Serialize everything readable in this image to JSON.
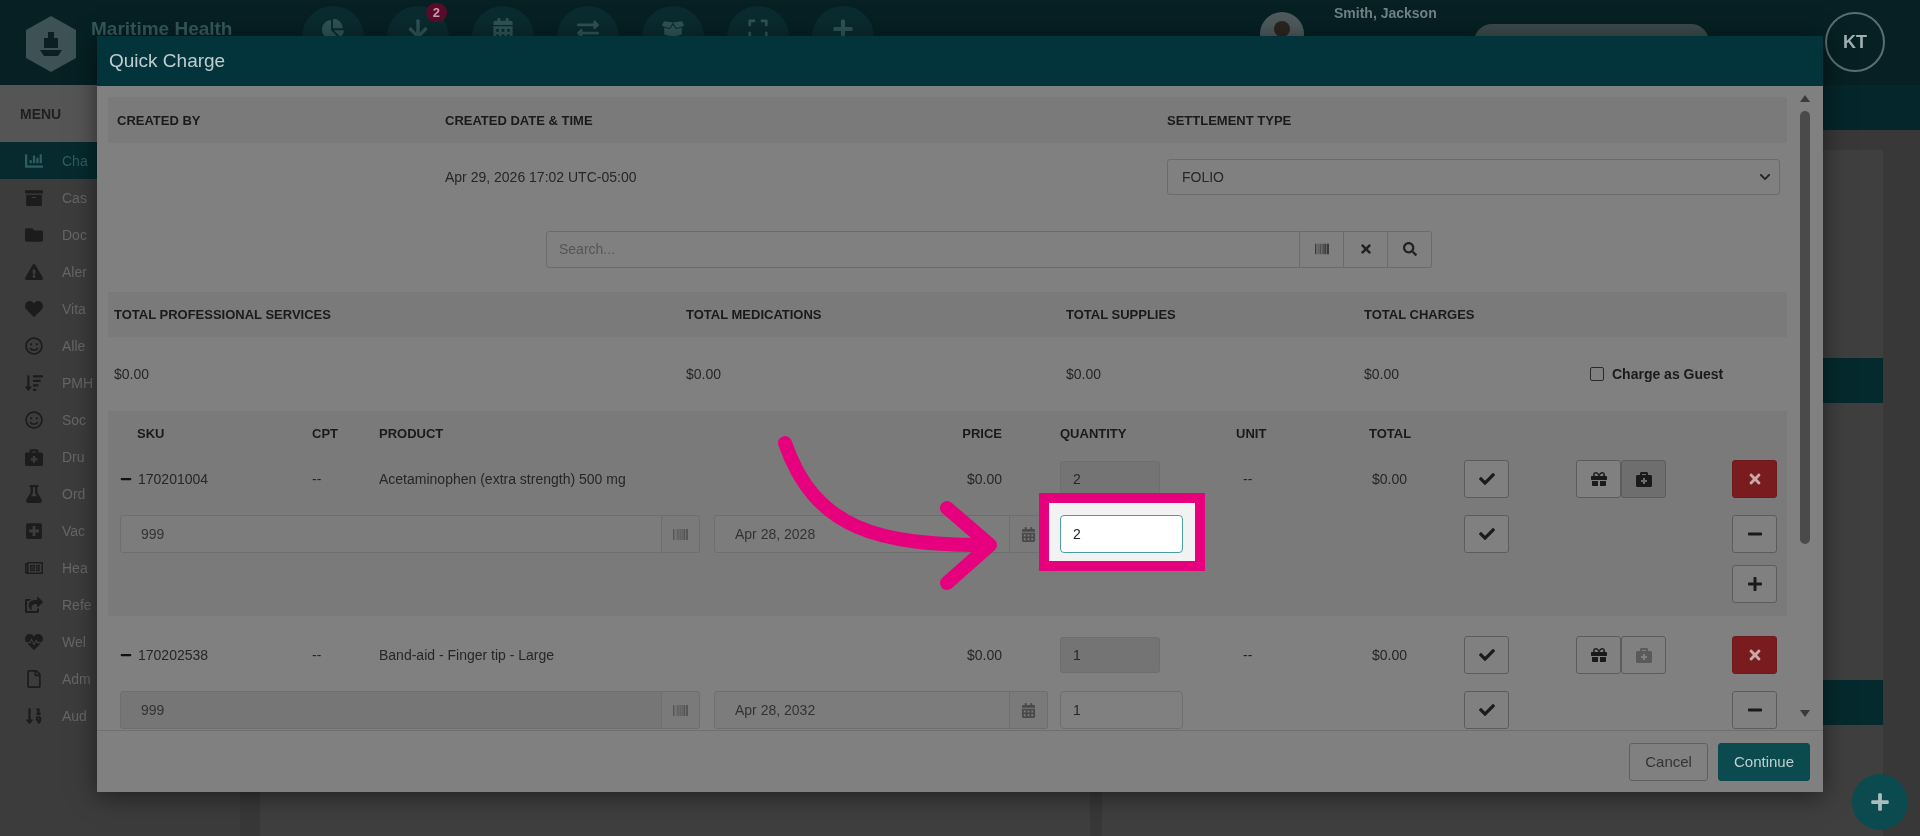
{
  "app": {
    "title": "Maritime Health",
    "notification_count": "2",
    "patient_name": "Smith, Jackson",
    "user_initials": "KT",
    "menu_label": "MENU",
    "sidebar": [
      {
        "label": "Cha",
        "selected": true
      },
      {
        "label": "Cas",
        "selected": false
      },
      {
        "label": "Doc",
        "selected": false
      },
      {
        "label": "Aler",
        "selected": false
      },
      {
        "label": "Vita",
        "selected": false
      },
      {
        "label": "Alle",
        "selected": false
      },
      {
        "label": "PMH",
        "selected": false
      },
      {
        "label": "Soc",
        "selected": false
      },
      {
        "label": "Dru",
        "selected": false
      },
      {
        "label": "Ord",
        "selected": false
      },
      {
        "label": "Vac",
        "selected": false
      },
      {
        "label": "Hea",
        "selected": false
      },
      {
        "label": "Refe",
        "selected": false
      },
      {
        "label": "Wel",
        "selected": false
      },
      {
        "label": "Adm",
        "selected": false
      },
      {
        "label": "Aud",
        "selected": false
      }
    ]
  },
  "dialog": {
    "title": "Quick Charge",
    "created_by": {
      "header": "CREATED BY"
    },
    "created_at": {
      "header": "CREATED DATE & TIME",
      "value": "Apr 29, 2026 17:02 UTC-05:00"
    },
    "settlement_type": {
      "header": "SETTLEMENT TYPE",
      "value": "FOLIO"
    },
    "search": {
      "placeholder": "Search..."
    },
    "totals": [
      {
        "header": "TOTAL PROFESSIONAL SERVICES",
        "value": "$0.00"
      },
      {
        "header": "TOTAL MEDICATIONS",
        "value": "$0.00"
      },
      {
        "header": "TOTAL SUPPLIES",
        "value": "$0.00"
      },
      {
        "header": "TOTAL CHARGES",
        "value": "$0.00"
      }
    ],
    "charge_as_guest": {
      "label": "Charge as Guest",
      "checked": false
    },
    "columns": [
      "SKU",
      "CPT",
      "PRODUCT",
      "PRICE",
      "QUANTITY",
      "UNIT",
      "TOTAL"
    ],
    "items": [
      {
        "sku": "170201004",
        "cpt": "--",
        "product": "Acetaminophen (extra strength) 500 mg",
        "price": "$0.00",
        "quantity": "2",
        "unit": "--",
        "total": "$0.00",
        "medkit_selected": true,
        "lot": "999",
        "expiry": "Apr 28, 2028",
        "lot_quantity": "2",
        "highlighted": true,
        "add_button": true
      },
      {
        "sku": "170202538",
        "cpt": "--",
        "product": "Band-aid - Finger tip - Large",
        "price": "$0.00",
        "quantity": "1",
        "unit": "--",
        "total": "$0.00",
        "medkit_selected": false,
        "lot": "999",
        "expiry": "Apr 28, 2032",
        "lot_quantity": "1",
        "highlighted": false,
        "add_button": false
      }
    ],
    "buttons": [
      {
        "label": "Cancel",
        "kind": "secondary"
      },
      {
        "label": "Continue",
        "kind": "primary"
      }
    ]
  }
}
